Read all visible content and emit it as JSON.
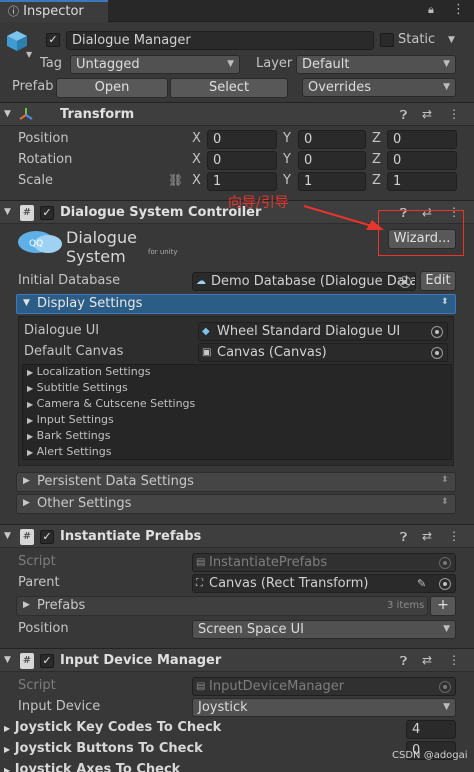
{
  "tab": {
    "label": "Inspector"
  },
  "gameobject": {
    "name": "Dialogue Manager",
    "static_label": "Static",
    "tag_label": "Tag",
    "tag_value": "Untagged",
    "layer_label": "Layer",
    "layer_value": "Default",
    "prefab_label": "Prefab",
    "open_label": "Open",
    "select_label": "Select",
    "overrides_label": "Overrides"
  },
  "transform": {
    "title": "Transform",
    "position": "Position",
    "rotation": "Rotation",
    "scale": "Scale",
    "pos": [
      "0",
      "0",
      "0"
    ],
    "rot": [
      "0",
      "0",
      "0"
    ],
    "scl": [
      "1",
      "1",
      "1"
    ],
    "axes": [
      "X",
      "Y",
      "Z"
    ]
  },
  "dsc": {
    "title": "Dialogue System Controller",
    "logo_title": "Dialogue System",
    "logo_sub": "for unity",
    "wizard_label": "Wizard...",
    "annotation": "向导/引导",
    "initial_db_label": "Initial Database",
    "initial_db_value": "Demo Database (Dialogue Data",
    "edit_label": "Edit",
    "display_settings": "Display Settings",
    "dialogue_ui_label": "Dialogue UI",
    "dialogue_ui_value": "Wheel Standard Dialogue UI",
    "default_canvas_label": "Default Canvas",
    "default_canvas_value": "Canvas (Canvas)",
    "subitems": [
      "Localization Settings",
      "Subtitle Settings",
      "Camera & Cutscene Settings",
      "Input Settings",
      "Bark Settings",
      "Alert Settings"
    ],
    "persistent": "Persistent Data Settings",
    "other": "Other Settings"
  },
  "ip": {
    "title": "Instantiate Prefabs",
    "script_label": "Script",
    "script_value": "InstantiatePrefabs",
    "parent_label": "Parent",
    "parent_value": "Canvas (Rect Transform)",
    "prefabs_label": "Prefabs",
    "prefabs_count": "3 items",
    "position_label": "Position",
    "position_value": "Screen Space UI"
  },
  "idm": {
    "title": "Input Device Manager",
    "script_label": "Script",
    "script_value": "InputDeviceManager",
    "device_label": "Input Device",
    "device_value": "Joystick",
    "keycodes_label": "Joystick Key Codes To Check",
    "keycodes_value": "4",
    "buttons_label": "Joystick Buttons To Check",
    "buttons_value": "0",
    "axes_label": "Joystick Axes To Check"
  },
  "watermark": "CSDN @adogai",
  "colors": {
    "background": "#383838",
    "header": "#3e3e3e",
    "accent": "#3a79bb",
    "annotation": "#e8342c"
  }
}
